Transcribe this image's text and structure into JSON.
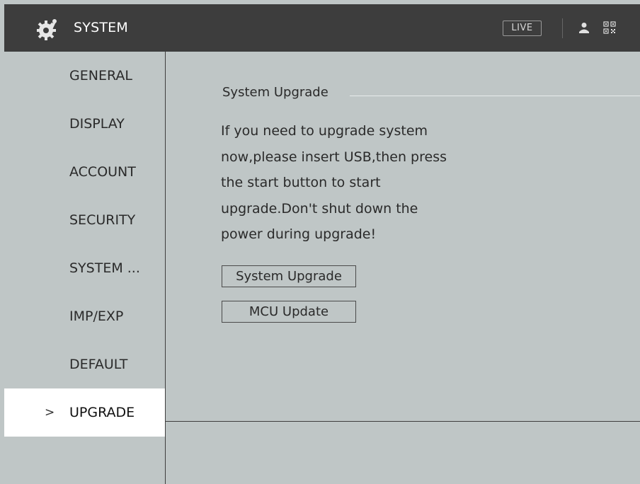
{
  "header": {
    "title": "SYSTEM",
    "live_label": "LIVE",
    "icons": [
      "gear-icon",
      "user-icon",
      "qr-code-icon"
    ]
  },
  "sidebar": {
    "items": [
      {
        "label": "GENERAL",
        "active": false
      },
      {
        "label": "DISPLAY",
        "active": false
      },
      {
        "label": "ACCOUNT",
        "active": false
      },
      {
        "label": "SECURITY",
        "active": false
      },
      {
        "label": "SYSTEM ...",
        "active": false
      },
      {
        "label": "IMP/EXP",
        "active": false
      },
      {
        "label": "DEFAULT",
        "active": false
      },
      {
        "label": "UPGRADE",
        "active": true
      }
    ],
    "active_marker": ">"
  },
  "main": {
    "section_title": "System Upgrade",
    "message_lines": [
      "If you need to upgrade system",
      "now,please insert USB,then press",
      "the start button to start",
      "upgrade.Don't shut down the",
      "power during upgrade!"
    ],
    "system_upgrade_button": "System Upgrade",
    "mcu_update_button": "MCU Update"
  },
  "colors": {
    "header_bg": "#3d3d3d",
    "panel_bg": "#bfc6c6",
    "active_item_bg": "#ffffff"
  }
}
